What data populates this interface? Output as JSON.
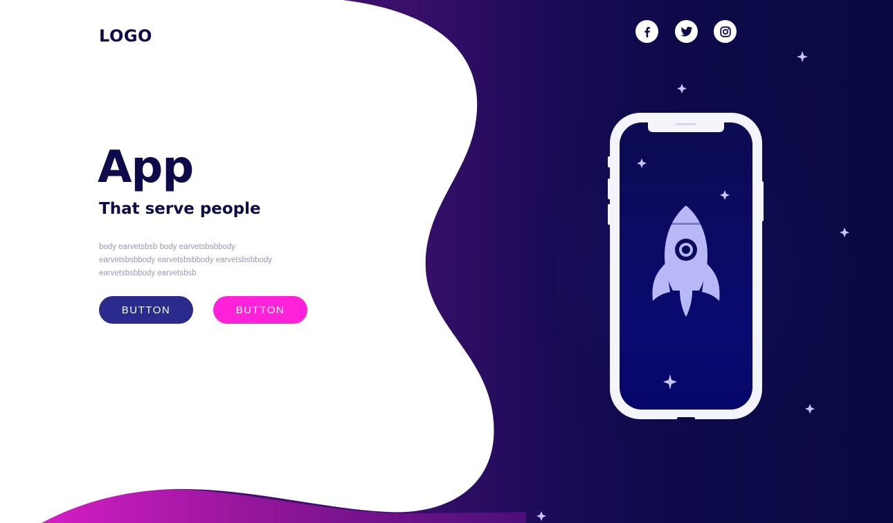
{
  "header": {
    "logo": "LOGO",
    "social": [
      {
        "icon": "facebook-icon"
      },
      {
        "icon": "twitter-icon"
      },
      {
        "icon": "instagram-icon"
      }
    ]
  },
  "hero": {
    "title": "App",
    "subtitle": "That serve people",
    "body_lines": [
      "body earvetsbsb body earvetsbsbbody",
      "earvetsbsbbody earvetsbsbbody earvetsbsbbody",
      "earvetsbsbbody earvetsbsb"
    ],
    "buttons": {
      "primary_label": "BUTTON",
      "secondary_label": "BUTTON"
    }
  },
  "illustration": {
    "device": "smartphone",
    "screen_icon": "rocket-icon"
  },
  "colors": {
    "navy": "#0e0b4a",
    "primary_button": "#2b2b8e",
    "accent_pink": "#ff22d8",
    "purple": "#5a1480",
    "space_dark": "#0b0a45"
  }
}
